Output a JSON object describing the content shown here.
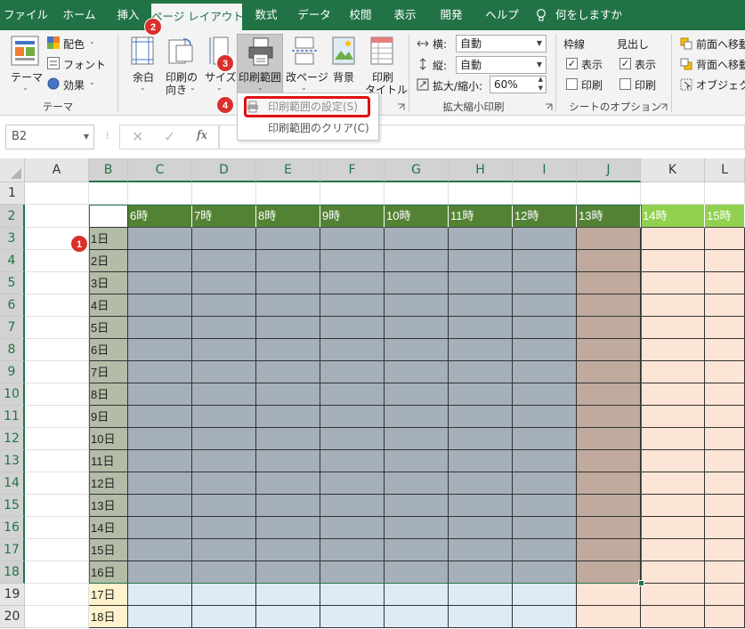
{
  "tabs": [
    "ファイル",
    "ホーム",
    "挿入",
    "ページ レイアウト",
    "数式",
    "データ",
    "校閲",
    "表示",
    "開発",
    "ヘルプ"
  ],
  "tell_me": "何をしますか",
  "ribbon": {
    "theme": {
      "themes_label": "テーマ",
      "colors_label": "配色",
      "fonts_label": "フォント",
      "effects_label": "効果",
      "group_label": "テーマ"
    },
    "page_setup": {
      "margins_label": "余白",
      "orientation_label_1": "印刷の",
      "orientation_label_2": "向き",
      "size_label": "サイズ",
      "print_area_label": "印刷範囲",
      "breaks_label": "改ページ",
      "background_label": "背景",
      "print_titles_label_1": "印刷",
      "print_titles_label_2": "タイトル"
    },
    "scale": {
      "width_label": "横:",
      "width_value": "自動",
      "height_label": "縦:",
      "height_value": "自動",
      "scale_label": "拡大/縮小:",
      "scale_value": "60%",
      "group_label": "拡大縮小印刷"
    },
    "sheet_options": {
      "gridlines_label": "枠線",
      "headings_label": "見出し",
      "view_label": "表示",
      "print_label": "印刷",
      "group_label": "シートのオプション",
      "gridlines_view": true,
      "gridlines_print": false,
      "headings_view": true,
      "headings_print": false
    },
    "arrange": {
      "bring_forward": "前面へ移動",
      "send_backward": "背面へ移動",
      "selection_pane": "オブジェクトの"
    }
  },
  "dropdown": {
    "set_print_area": "印刷範囲の設定(S)",
    "clear_print_area": "印刷範囲のクリア(C)"
  },
  "badges": [
    "1",
    "2",
    "3",
    "4"
  ],
  "name_box": "B2",
  "fx": "fx",
  "columns": [
    "A",
    "B",
    "C",
    "D",
    "E",
    "F",
    "G",
    "H",
    "I",
    "J",
    "K",
    "L"
  ],
  "rows": [
    "1",
    "2",
    "3",
    "4",
    "5",
    "6",
    "7",
    "8",
    "9",
    "10",
    "11",
    "12",
    "13",
    "14",
    "15",
    "16",
    "17",
    "18",
    "19",
    "20"
  ],
  "hour_headers": [
    "6時",
    "7時",
    "8時",
    "9時",
    "10時",
    "11時",
    "12時",
    "13時",
    "14時",
    "15時"
  ],
  "day_labels": [
    "1日",
    "2日",
    "3日",
    "4日",
    "5日",
    "6日",
    "7日",
    "8日",
    "9日",
    "10日",
    "11日",
    "12日",
    "13日",
    "14日",
    "15日",
    "16日",
    "17日",
    "18日"
  ],
  "colors": {
    "excel_green": "#217346",
    "header_dark_green": "#548235",
    "header_light_green": "#92d050",
    "selected_gray": "#a6b0bb",
    "selected_brown": "#c0aa9e",
    "day_selected": "#b2bca6",
    "day_unselected": "#fff2cc",
    "blue_cell": "#ddebf7",
    "peach_cell": "#fce4d6",
    "badge_red": "#d9302c"
  }
}
